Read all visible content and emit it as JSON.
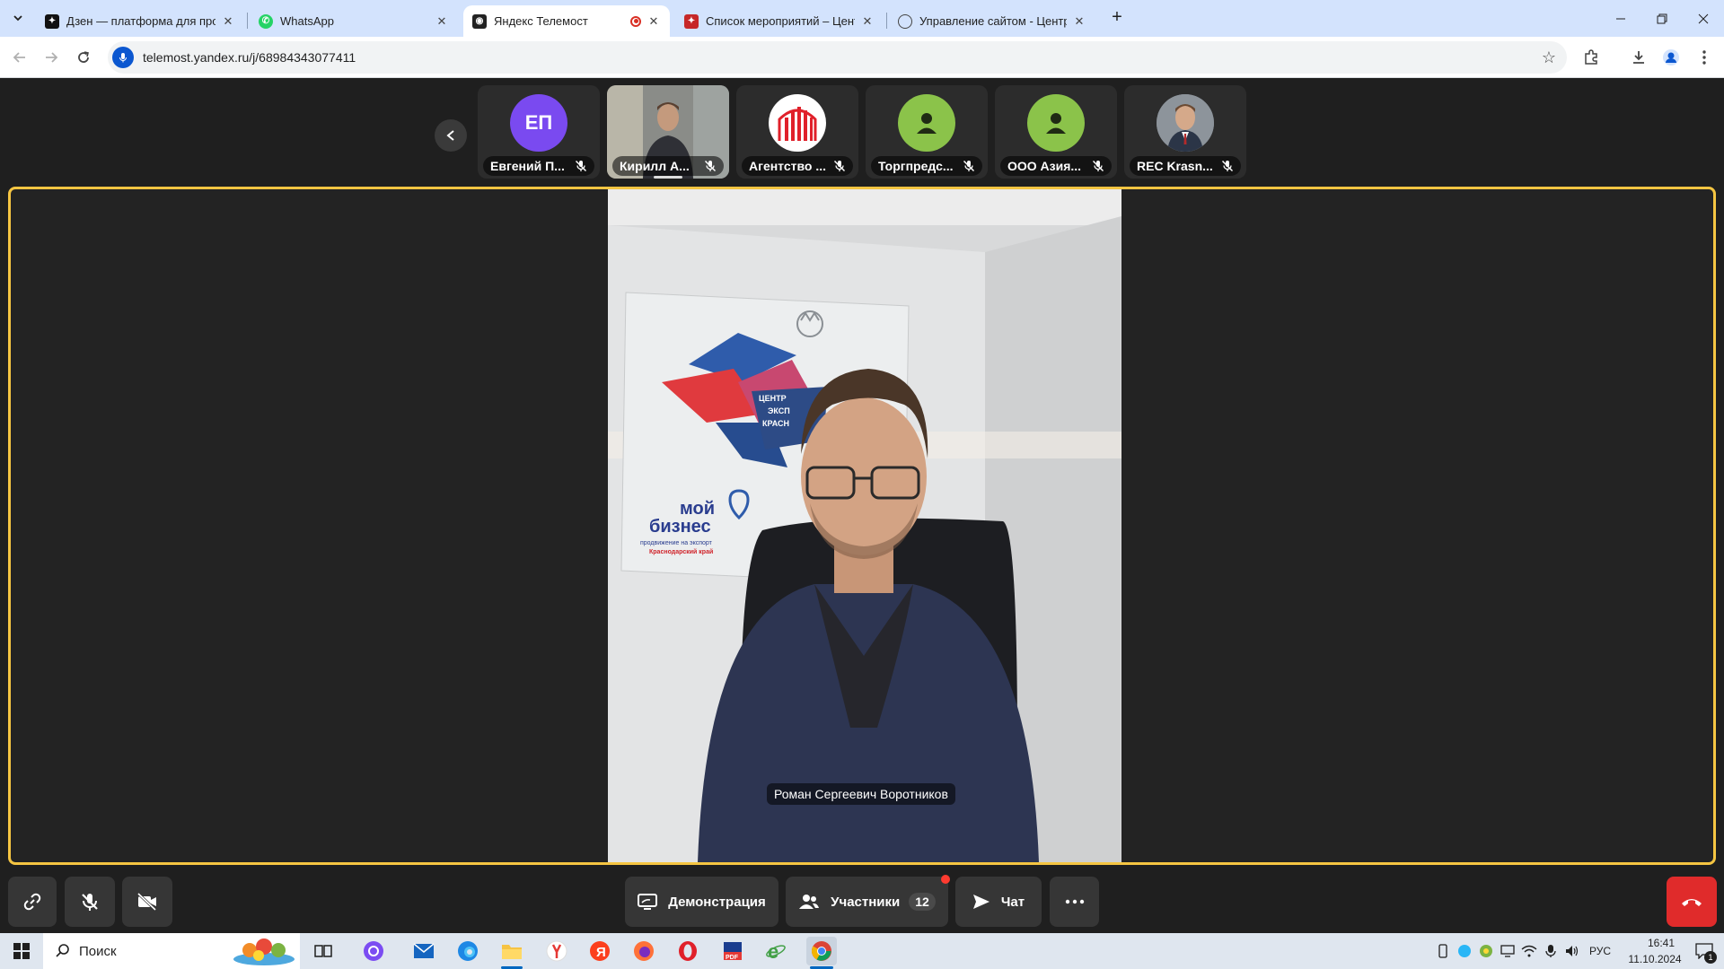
{
  "browser": {
    "tabs": [
      {
        "title": "Дзен — платформа для просм",
        "active": false
      },
      {
        "title": "WhatsApp",
        "active": false
      },
      {
        "title": "Яндекс Телемост",
        "active": true
      },
      {
        "title": "Список мероприятий – Центр",
        "active": false
      },
      {
        "title": "Управление сайтом - Центр п",
        "active": false
      }
    ],
    "url": "telemost.yandex.ru/j/68984343077411"
  },
  "participants": [
    {
      "name": "Евгений П...",
      "initials": "ЕП",
      "avatar_color": "#7a4af0",
      "type": "initials"
    },
    {
      "name": "Кирилл А...",
      "type": "video"
    },
    {
      "name": "Агентство ...",
      "type": "logo"
    },
    {
      "name": "Торгпредс...",
      "type": "generic",
      "avatar_color": "#8bc34a"
    },
    {
      "name": "ООО Азия...",
      "type": "generic",
      "avatar_color": "#8bc34a"
    },
    {
      "name": "REC Krasn...",
      "type": "photo"
    }
  ],
  "stage": {
    "speaker_name": "Роман Сергеевич Воротников",
    "border_color": "#f5c542",
    "poster": {
      "brand_line1": "мой",
      "brand_line2": "бизнес",
      "tagline": "продвижение на экспорт",
      "region": "Краснодарский край",
      "center_text_1": "ЦЕНТР",
      "center_text_2": "ЭКСП",
      "center_text_3": "КРАСН"
    }
  },
  "controls": {
    "demo_label": "Демонстрация",
    "participants_label": "Участники",
    "participants_count": "12",
    "chat_label": "Чат"
  },
  "taskbar": {
    "search_placeholder": "Поиск",
    "language": "РУС",
    "time": "16:41",
    "date": "11.10.2024",
    "notification_count": "1"
  }
}
